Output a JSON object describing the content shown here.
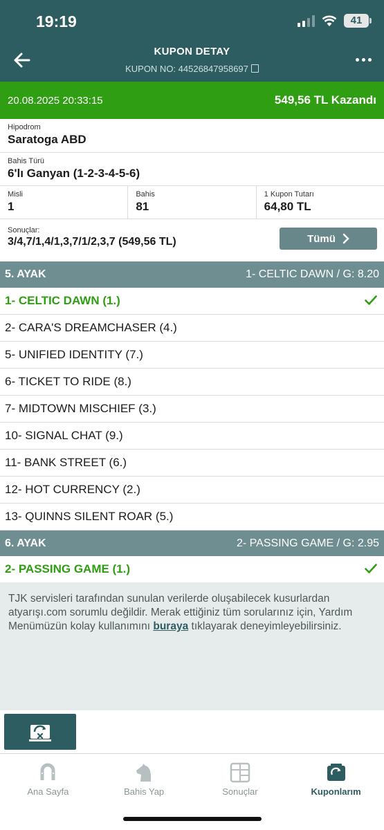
{
  "status_bar": {
    "time": "19:19",
    "battery": "41"
  },
  "header": {
    "title": "KUPON DETAY",
    "coupon_no": "KUPON NO: 44526847958697"
  },
  "win_bar": {
    "date": "20.08.2025 20:33:15",
    "amount": "549,56 TL Kazandı"
  },
  "coupon": {
    "hippodrome_label": "Hipodrom",
    "hippodrome": "Saratoga ABD",
    "bet_type_label": "Bahis Türü",
    "bet_type": "6'lı Ganyan (1-2-3-4-5-6)",
    "misli_label": "Misli",
    "misli": "1",
    "bahis_label": "Bahis",
    "bahis": "81",
    "amount_label": "1 Kupon Tutarı",
    "amount": "64,80 TL",
    "results_label": "Sonuçlar:",
    "results": "3/4,7/1,4/1,3,7/1/2,3,7 (549,56 TL)",
    "all_button": "Tümü"
  },
  "legs": [
    {
      "name": "5. AYAK",
      "result": "1- CELTIC DAWN / G: 8.20",
      "horses": [
        "1- CELTIC DAWN (1.)",
        "2- CARA'S DREAMCHASER (4.)",
        "5- UNIFIED IDENTITY (7.)",
        "6- TICKET TO RIDE (8.)",
        "7- MIDTOWN MISCHIEF (3.)",
        "10- SIGNAL CHAT (9.)",
        "11- BANK STREET (6.)",
        "12- HOT CURRENCY (2.)",
        "13- QUINNS SILENT ROAR (5.)"
      ]
    },
    {
      "name": "6. AYAK",
      "result": "2- PASSING GAME / G: 2.95",
      "horses": [
        "2- PASSING GAME (1.)"
      ]
    }
  ],
  "footer": {
    "text_before": "TJK servisleri tarafından sunulan verilerde oluşabilecek kusurlardan atyarışı.com sorumlu değildir. Merak ettiğiniz tüm sorularınız için, Yardım Menümüzün kolay kullanımını ",
    "link": "buraya",
    "text_after": " tıklayarak deneyimleyebilirsiniz."
  },
  "tabs": [
    {
      "label": "Ana Sayfa",
      "icon": "horseshoe-icon"
    },
    {
      "label": "Bahis Yap",
      "icon": "horse-head-icon"
    },
    {
      "label": "Sonuçlar",
      "icon": "results-board-icon"
    },
    {
      "label": "Kuponlarım",
      "icon": "coupon-icon"
    }
  ],
  "colors": {
    "header": "#2d5c61",
    "win": "#2f9e12",
    "leg_bar": "#6e8e91"
  }
}
